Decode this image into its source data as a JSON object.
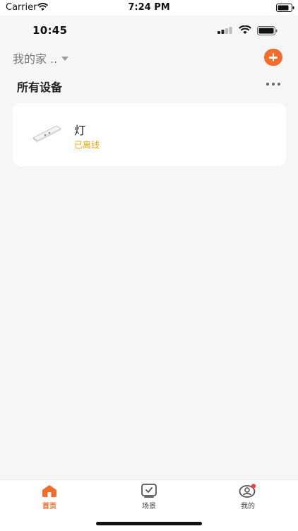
{
  "system_status": {
    "carrier": "Carrier",
    "time": "7:24 PM"
  },
  "app_status": {
    "time": "10:45"
  },
  "header": {
    "home_name": "我的家 ..",
    "section_title": "所有设备"
  },
  "devices": [
    {
      "name": "灯",
      "status": "已离线",
      "icon": "light-strip-image"
    }
  ],
  "tabs": [
    {
      "label": "首页",
      "icon": "home-icon",
      "active": true
    },
    {
      "label": "场景",
      "icon": "scene-icon",
      "active": false
    },
    {
      "label": "我的",
      "icon": "profile-icon",
      "active": false,
      "badge": true
    }
  ],
  "colors": {
    "accent": "#f26c2b",
    "offline": "#f2a50c",
    "badge": "#f0434f",
    "background": "#f6f6f6"
  }
}
